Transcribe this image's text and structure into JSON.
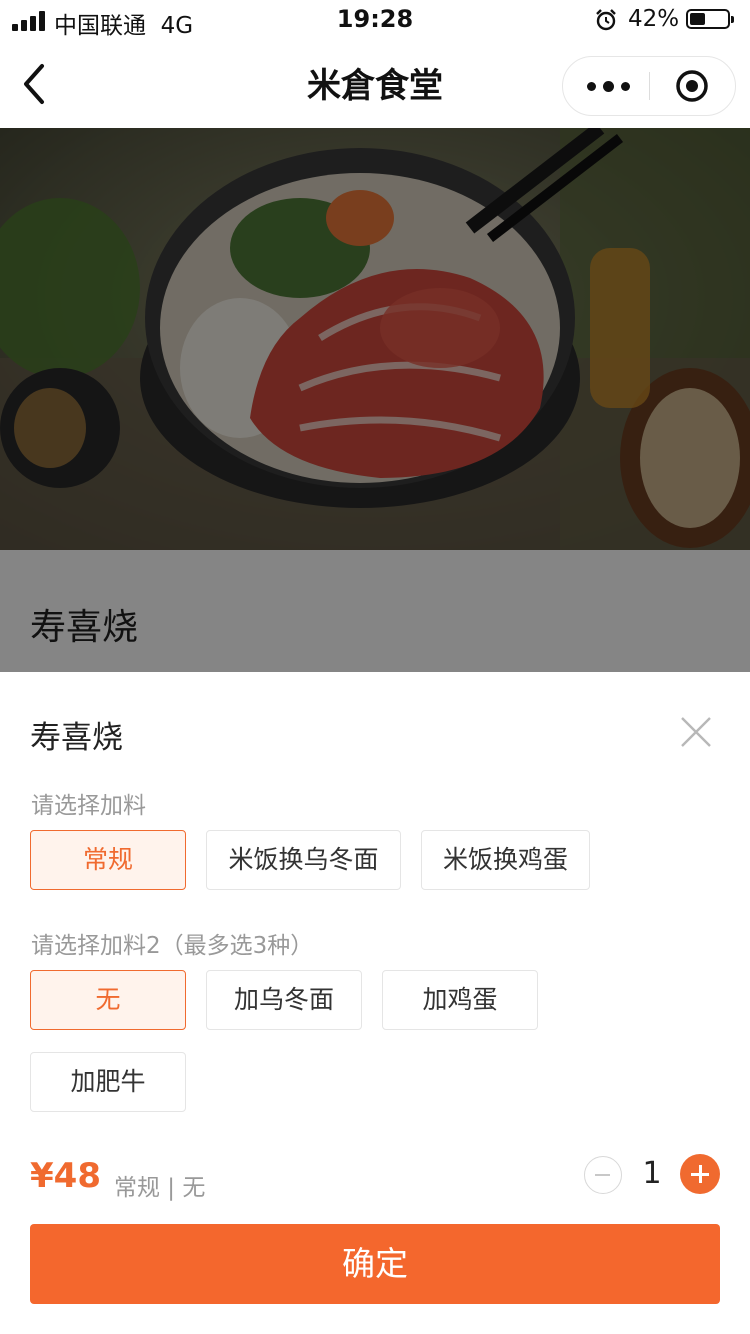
{
  "status_bar": {
    "carrier": "中国联通",
    "network": "4G",
    "time": "19:28",
    "battery": "42%",
    "battery_level": 0.42
  },
  "nav": {
    "title": "米倉食堂"
  },
  "product": {
    "name": "寿喜烧"
  },
  "sheet": {
    "title": "寿喜烧",
    "group1": {
      "label": "请选择加料",
      "options": [
        "常规",
        "米饭换乌冬面",
        "米饭换鸡蛋"
      ],
      "selected": "常规"
    },
    "group2": {
      "label": "请选择加料2（最多选3种）",
      "options": [
        "无",
        "加乌冬面",
        "加鸡蛋",
        "加肥牛"
      ],
      "selected": "无"
    },
    "price": "¥48",
    "price_desc": "常规 | 无",
    "quantity": "1",
    "confirm_label": "确定"
  },
  "colors": {
    "accent": "#f06a2f",
    "button": "#f4672d"
  }
}
